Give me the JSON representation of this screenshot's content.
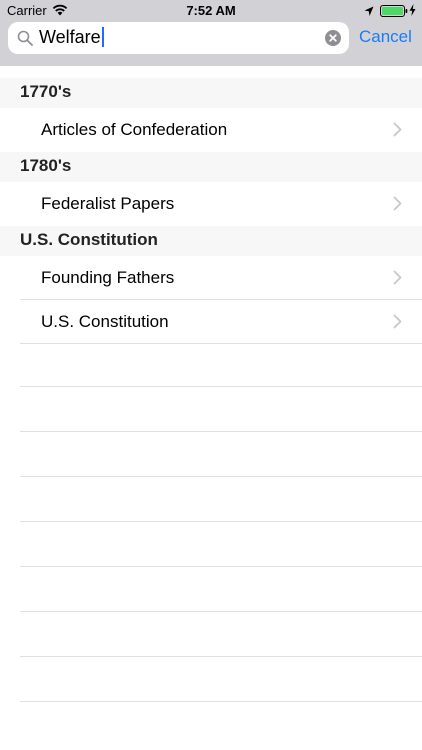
{
  "status": {
    "carrier": "Carrier",
    "time": "7:52 AM"
  },
  "search": {
    "query": "Welfare",
    "cancel_label": "Cancel"
  },
  "sections": [
    {
      "header": "1770's",
      "items": [
        "Articles of Confederation"
      ]
    },
    {
      "header": "1780's",
      "items": [
        "Federalist Papers"
      ]
    },
    {
      "header": "U.S. Constitution",
      "items": [
        "Founding Fathers",
        "U.S. Constitution"
      ]
    }
  ],
  "icons": {
    "wifi": "wifi-icon",
    "location": "location-arrow-icon",
    "battery": "battery-icon",
    "charging": "charging-bolt-icon",
    "search": "search-icon",
    "clear": "clear-icon",
    "chevron": "chevron-right-icon"
  },
  "colors": {
    "accent": "#1a7cf5",
    "bar_background": "#d2d2d6",
    "battery": "#4cd964",
    "section_header_background": "#f7f7f7"
  }
}
